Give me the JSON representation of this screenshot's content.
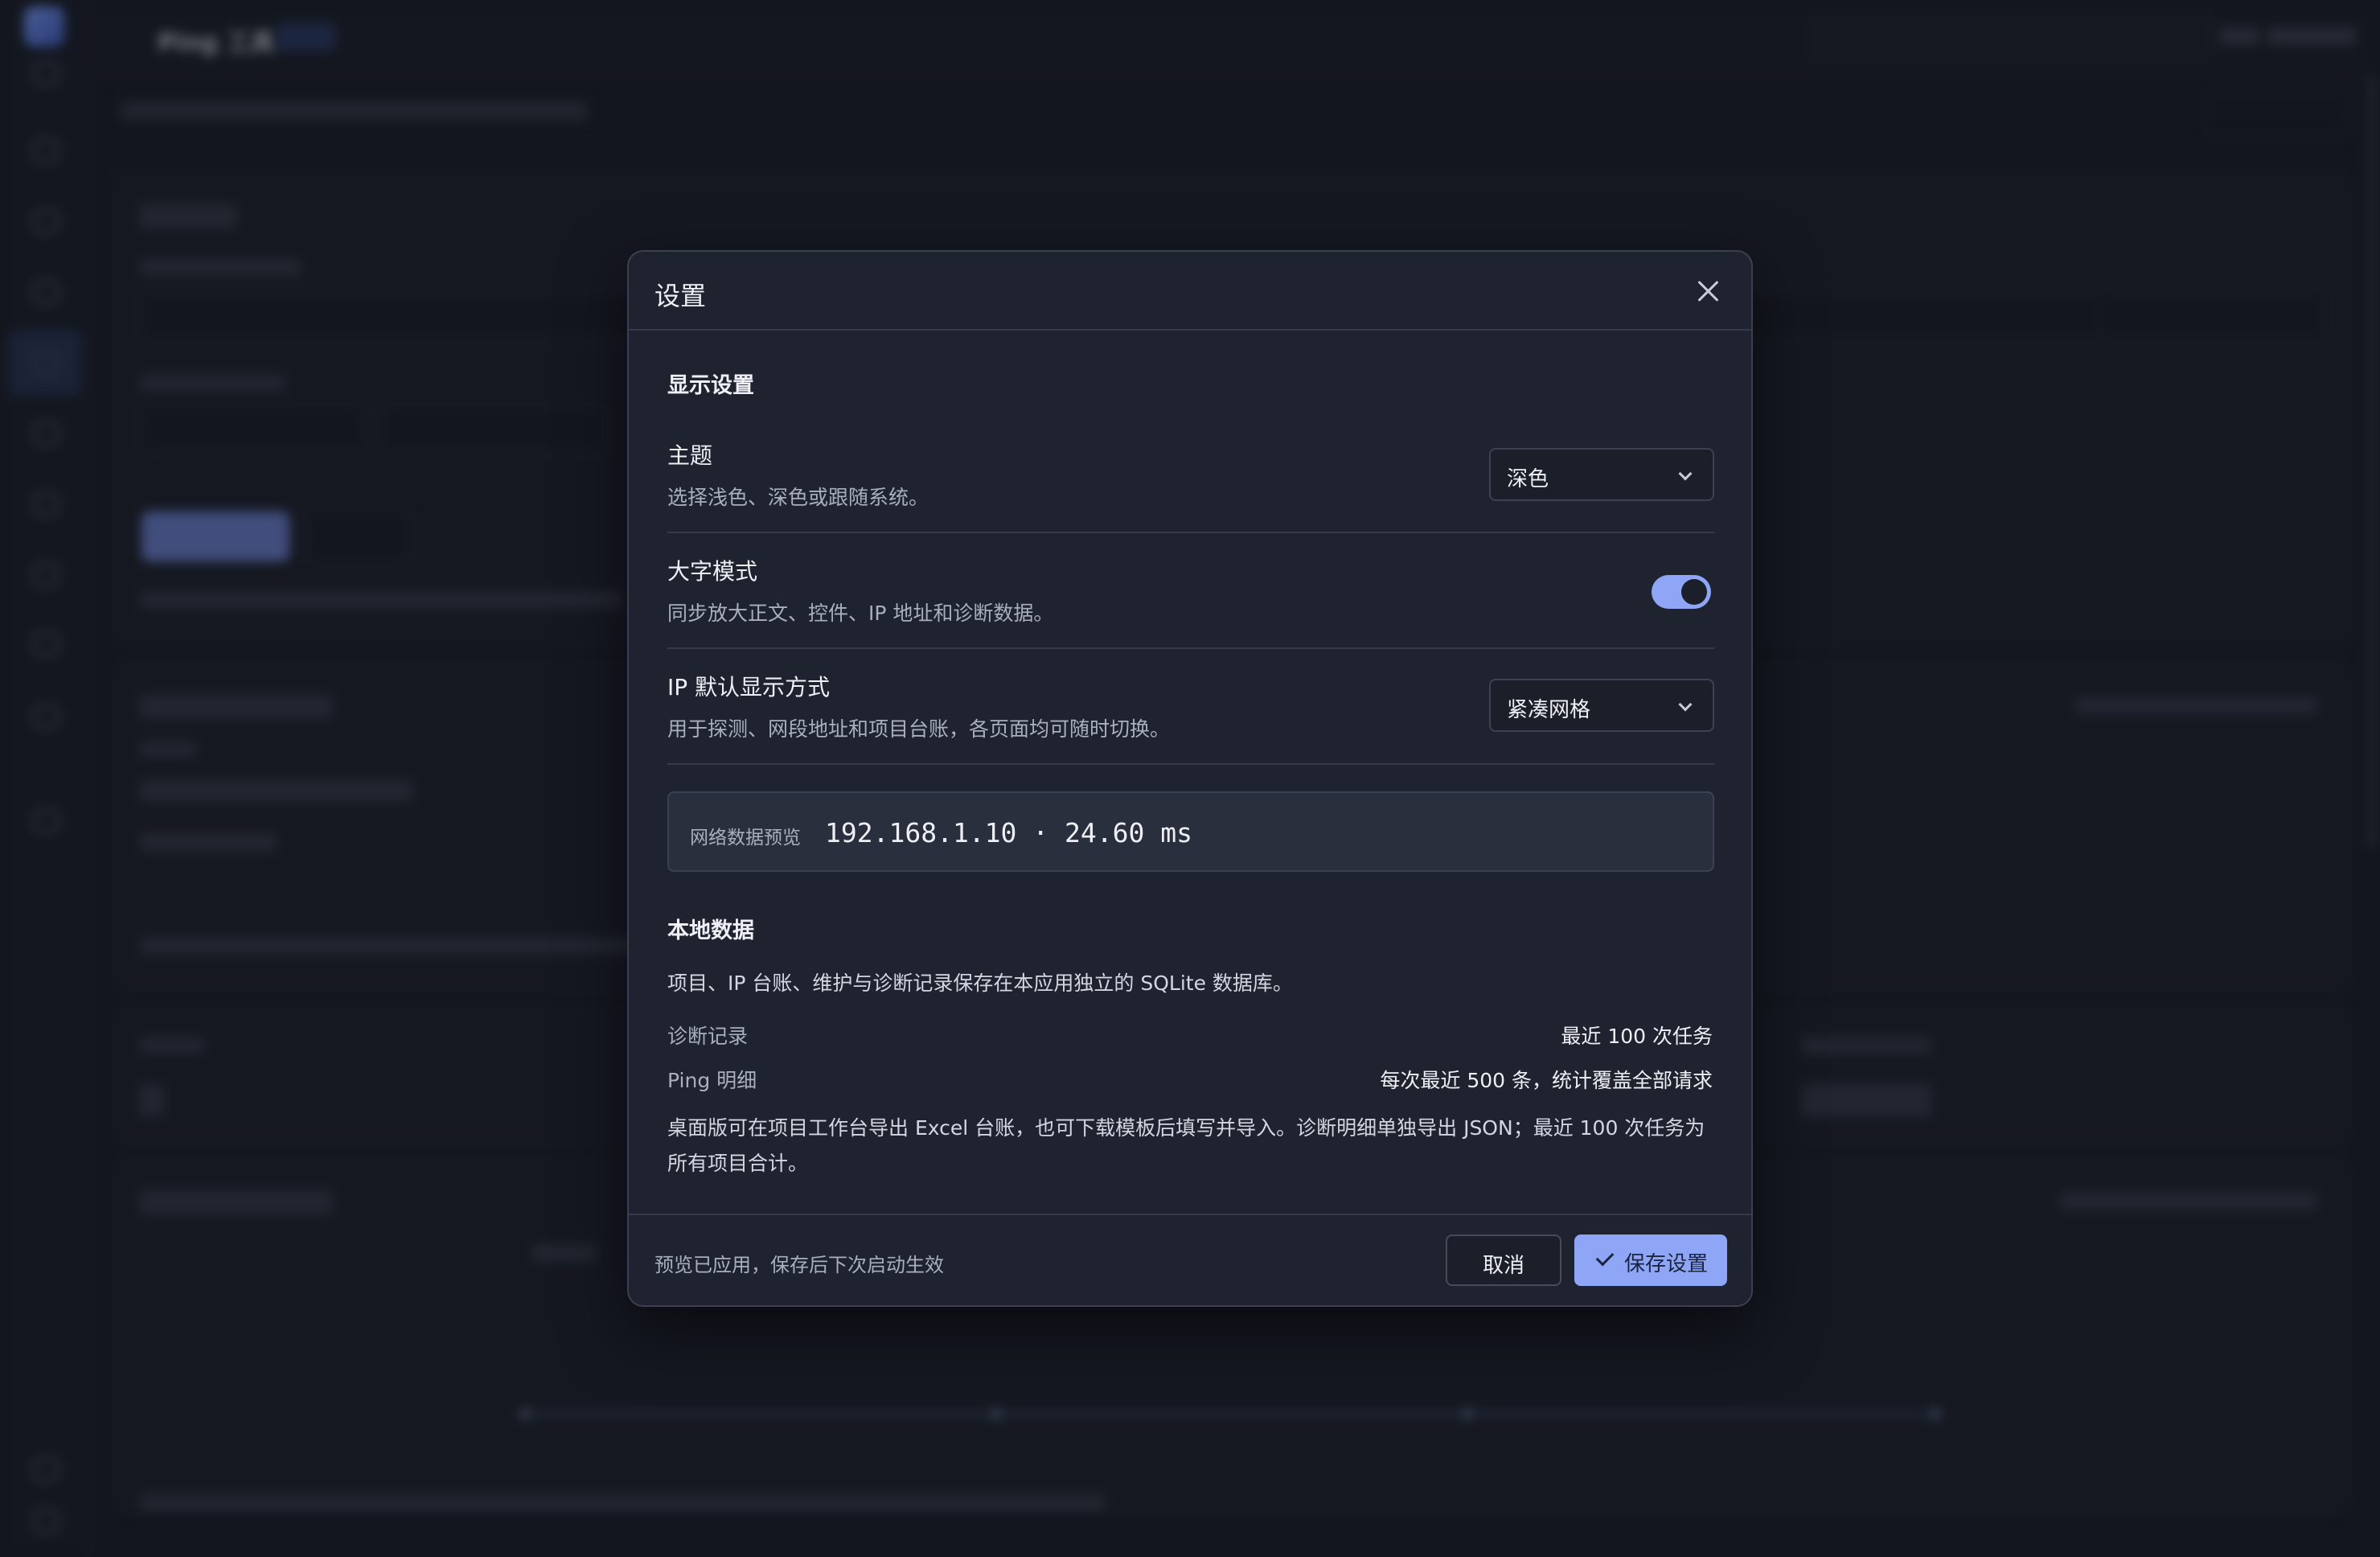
{
  "background": {
    "app_title": "Ping 工具"
  },
  "modal": {
    "title": "设置",
    "display_section": {
      "title": "显示设置",
      "theme": {
        "label": "主题",
        "description": "选择浅色、深色或跟随系统。",
        "value": "深色"
      },
      "large_text": {
        "label": "大字模式",
        "description": "同步放大正文、控件、IP 地址和诊断数据。",
        "enabled": true
      },
      "ip_display": {
        "label": "IP 默认显示方式",
        "description": "用于探测、网段地址和项目台账，各页面均可随时切换。",
        "value": "紧凑网格"
      },
      "preview": {
        "label": "网络数据预览",
        "value": "192.168.1.10 · 24.60 ms"
      }
    },
    "local_data_section": {
      "title": "本地数据",
      "description": "项目、IP 台账、维护与诊断记录保存在本应用独立的 SQLite 数据库。",
      "rows": [
        {
          "key": "诊断记录",
          "value": "最近 100 次任务"
        },
        {
          "key": "Ping 明细",
          "value": "每次最近 500 条，统计覆盖全部请求"
        }
      ],
      "note": "桌面版可在项目工作台导出 Excel 台账，也可下载模板后填写并导入。诊断明细单独导出 JSON；最近 100 次任务为所有项目合计。"
    },
    "footer": {
      "note": "预览已应用，保存后下次启动生效",
      "cancel_label": "取消",
      "save_label": "保存设置"
    }
  },
  "colors": {
    "accent": "#8fa5f5",
    "modal_bg": "#1f2330",
    "page_bg": "#1a1e27"
  }
}
